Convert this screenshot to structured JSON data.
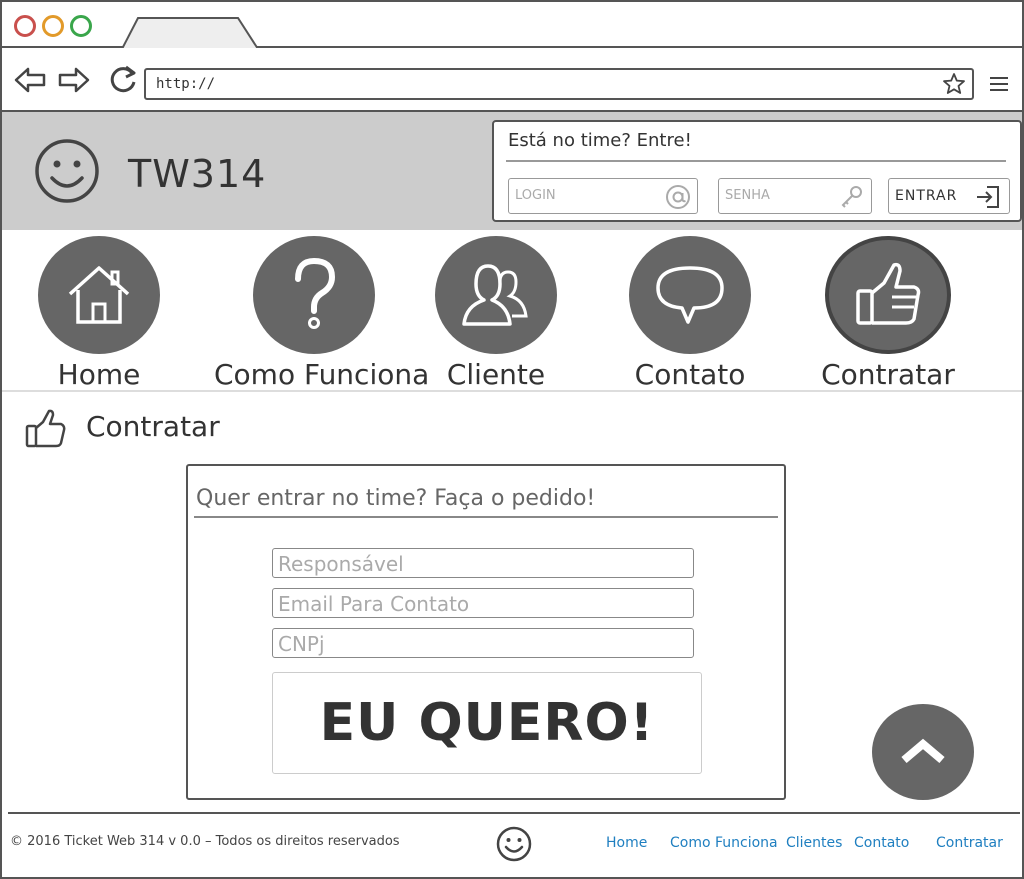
{
  "browser": {
    "url": "http://",
    "window_buttons": [
      "close",
      "minimize",
      "maximize"
    ]
  },
  "header": {
    "brand": "TW314",
    "login": {
      "title": "Está no time? Entre!",
      "login_placeholder": "LOGIN",
      "password_placeholder": "SENHA",
      "submit_label": "ENTRAR"
    }
  },
  "nav": {
    "items": [
      {
        "label": "Home",
        "icon": "house-icon"
      },
      {
        "label": "Como Funciona",
        "icon": "question-icon"
      },
      {
        "label": "Cliente",
        "icon": "users-icon"
      },
      {
        "label": "Contato",
        "icon": "speech-bubble-icon"
      },
      {
        "label": "Contratar",
        "icon": "thumbs-up-icon",
        "active": true
      }
    ]
  },
  "page": {
    "title": "Contratar"
  },
  "form": {
    "title": "Quer entrar no time? Faça o pedido!",
    "fields": [
      {
        "placeholder": "Responsável"
      },
      {
        "placeholder": "Email Para Contato"
      },
      {
        "placeholder": "CNPj"
      }
    ],
    "submit_label": "EU QUERO!"
  },
  "footer": {
    "copyright": "© 2016 Ticket Web 314 v 0.0 – Todos os direitos reservados",
    "links": [
      "Home",
      "Como Funciona",
      "Clientes",
      "Contato",
      "Contratar"
    ]
  },
  "colors": {
    "header_bg": "#cccccc",
    "circle_bg": "#666666",
    "link": "#1f7fc0"
  }
}
